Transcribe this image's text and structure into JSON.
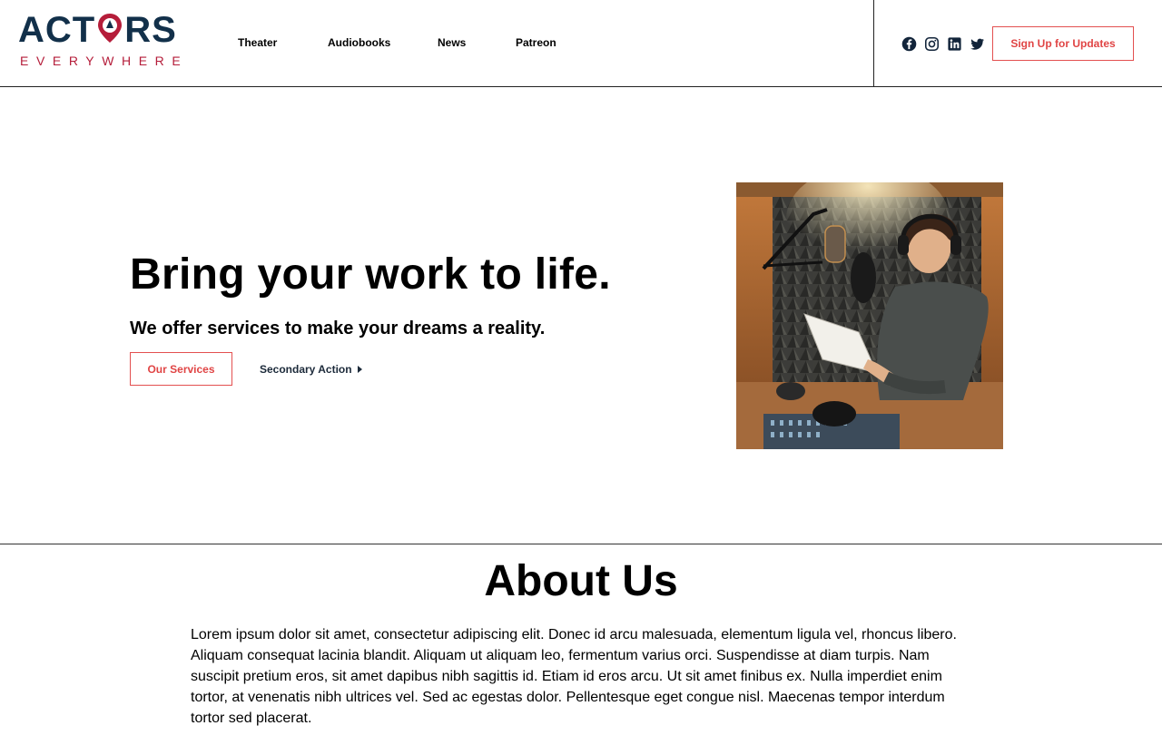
{
  "brand": {
    "logo_top_left": "ACT",
    "logo_top_right": "RS",
    "logo_bottom": "EVERYWHERE",
    "primary_color": "#12304a",
    "accent_color": "#b51d3a"
  },
  "nav": {
    "items": [
      {
        "label": "Theater"
      },
      {
        "label": "Audiobooks"
      },
      {
        "label": "News"
      },
      {
        "label": "Patreon"
      }
    ]
  },
  "socials": [
    {
      "icon": "facebook-icon"
    },
    {
      "icon": "instagram-icon"
    },
    {
      "icon": "linkedin-icon"
    },
    {
      "icon": "twitter-icon"
    }
  ],
  "header": {
    "signup_label": "Sign Up for Updates"
  },
  "hero": {
    "title": "Bring your work to life.",
    "subtitle": "We offer services to make your dreams a reality.",
    "primary_label": "Our Services",
    "secondary_label": "Secondary Action",
    "button_color": "#e35050"
  },
  "about": {
    "title": "About Us",
    "body": "Lorem ipsum dolor sit amet, consectetur adipiscing elit. Donec id arcu malesuada, elementum ligula vel, rhoncus libero. Aliquam consequat lacinia blandit. Aliquam ut aliquam leo, fermentum varius orci. Suspendisse at diam turpis. Nam suscipit pretium eros, sit amet dapibus nibh sagittis id. Etiam id eros arcu. Ut sit amet finibus ex. Nulla imperdiet enim tortor, at venenatis nibh ultrices vel. Sed ac egestas dolor. Pellentesque eget congue nisl. Maecenas tempor interdum tortor sed placerat."
  }
}
